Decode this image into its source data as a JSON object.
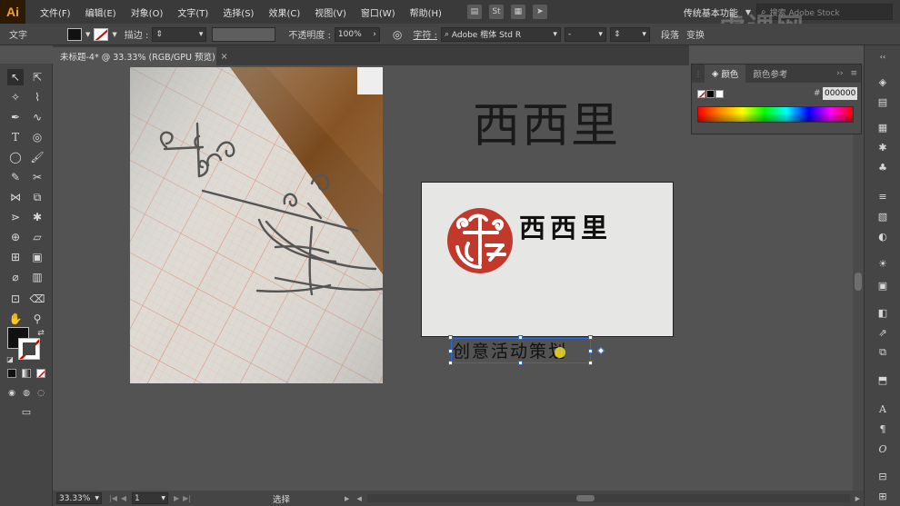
{
  "app": {
    "logo": "Ai"
  },
  "menu": [
    "文件(F)",
    "编辑(E)",
    "对象(O)",
    "文字(T)",
    "选择(S)",
    "效果(C)",
    "视图(V)",
    "窗口(W)",
    "帮助(H)"
  ],
  "menu_icons": {
    "st": "St"
  },
  "workspace": {
    "label": "传统基本功能"
  },
  "search": {
    "placeholder": "搜索 Adobe Stock"
  },
  "watermark": {
    "text": "虎课网"
  },
  "controlbar": {
    "type_label": "文字",
    "stroke_label": "描边 :",
    "opacity_label": "不透明度 :",
    "opacity_value": "100%",
    "char_label": "字符 :",
    "font_value": "Adobe 楷体 Std R",
    "font_style_value": "-",
    "para_label": "段落",
    "transform_label": "变换"
  },
  "document": {
    "tab_title": "未标题-4* @ 33.33% (RGB/GPU 预览)"
  },
  "artwork": {
    "heading": "西西里",
    "card_name": "西西里",
    "tagline": "创意活动策划",
    "logo_color": "#c0392b"
  },
  "color_panel": {
    "tabs": [
      "颜色",
      "颜色参考"
    ],
    "hex_label": "#",
    "hex_value": "000000"
  },
  "statusbar": {
    "zoom": "33.33%",
    "artboard": "1",
    "tool": "选择"
  },
  "colors": {
    "accent": "#f0a030",
    "selection": "#2a6ad8",
    "fill": "#111111"
  }
}
